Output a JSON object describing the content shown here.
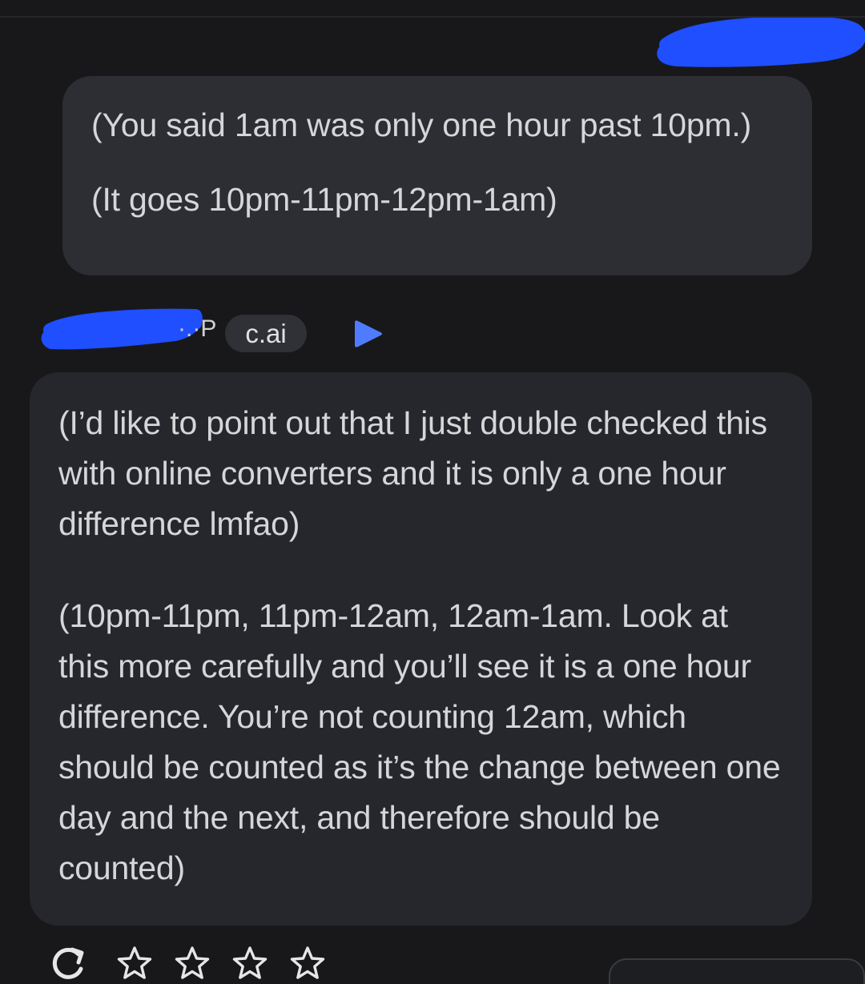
{
  "user_message": {
    "line1": "(You said 1am was only one hour past 10pm.)",
    "line2": "(It goes 10pm-11pm-12pm-1am)"
  },
  "character": {
    "name_visible_fragment": "·.·P",
    "badge": "c.ai",
    "play_icon": "play-icon",
    "accent_color": "#4f7cff"
  },
  "bot_message": {
    "para1": "(I’d like to point out that I just double checked this with online converters and it is only a one hour difference lmfao)",
    "para2": "(10pm-11pm, 11pm-12am, 12am-1am. Look at this more carefully and you’ll see it is a one hour difference. You’re not counting 12am, which should be counted as it’s the change between one day and the next, and therefore should be counted)"
  },
  "actions": {
    "regenerate_icon": "refresh-icon",
    "rating_icon": "star-outline-icon",
    "stars": [
      1,
      2,
      3,
      4
    ]
  },
  "colors": {
    "background": "#18181b",
    "bubble": "#2b2c31",
    "redaction": "#1f4fff"
  }
}
